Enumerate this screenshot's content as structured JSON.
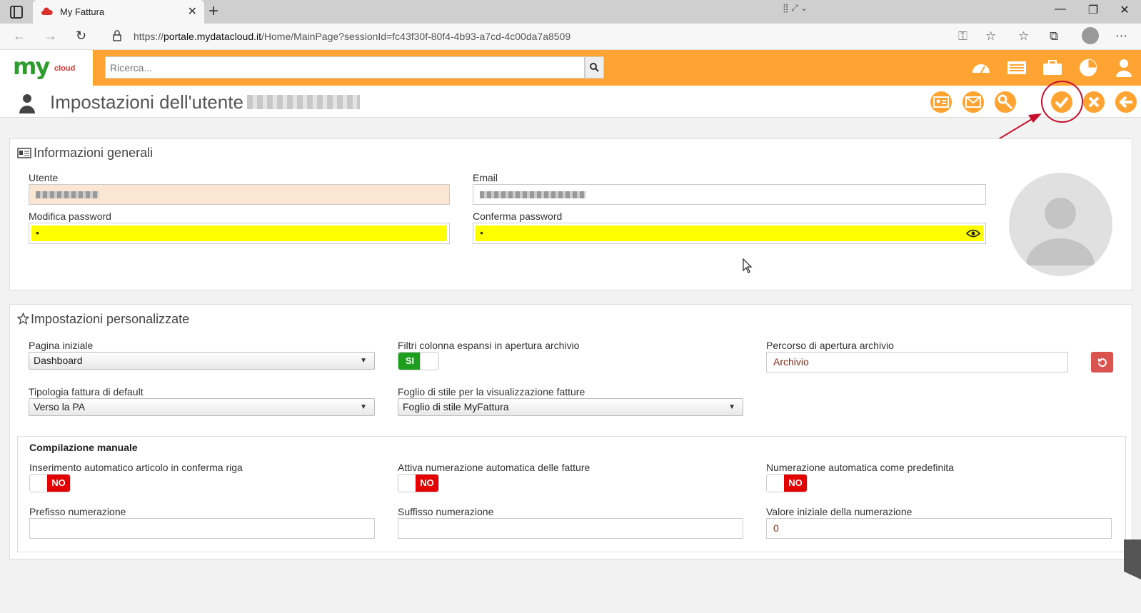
{
  "browser": {
    "tab_title": "My Fattura",
    "url_prefix": "https://",
    "url_host": "portale.mydatacloud.it",
    "url_path": "/Home/MainPage?sessionId=fc43f30f-80f4-4b93-a7cd-4c00da7a8509"
  },
  "header": {
    "logo_my": "my",
    "logo_cloud": "cloud",
    "search_placeholder": "Ricerca..."
  },
  "title": {
    "text": "Impostazioni dell'utente"
  },
  "general": {
    "title": "Informazioni generali",
    "utente_label": "Utente",
    "email_label": "Email",
    "modifica_password_label": "Modifica password",
    "modifica_password_value": "•",
    "conferma_password_label": "Conferma password",
    "conferma_password_value": "•"
  },
  "custom": {
    "title": "Impostazioni personalizzate",
    "pagina_iniziale_label": "Pagina iniziale",
    "pagina_iniziale_value": "Dashboard",
    "filtri_label": "Filtri colonna espansi in apertura archivio",
    "filtri_value": "SI",
    "percorso_label": "Percorso di apertura archivio",
    "percorso_value": "Archivio",
    "tipologia_label": "Tipologia fattura di default",
    "tipologia_value": "Verso la PA",
    "foglio_label": "Foglio di stile per la visualizzazione fatture",
    "foglio_value": "Foglio di stile MyFattura"
  },
  "manual": {
    "title": "Compilazione manuale",
    "inserimento_label": "Inserimento automatico articolo in conferma riga",
    "inserimento_value": "NO",
    "attiva_label": "Attiva numerazione automatica delle fatture",
    "attiva_value": "NO",
    "numerazione_label": "Numerazione automatica come predefinita",
    "numerazione_value": "NO",
    "prefisso_label": "Prefisso numerazione",
    "prefisso_value": "",
    "suffisso_label": "Suffisso numerazione",
    "suffisso_value": "",
    "valore_label": "Valore iniziale della numerazione",
    "valore_value": "0"
  },
  "colors": {
    "accent": "#ffa333",
    "highlight": "#ffff00",
    "toggle_on": "#1e9e1e",
    "toggle_off": "#e30000",
    "annotation": "#c8102e"
  }
}
